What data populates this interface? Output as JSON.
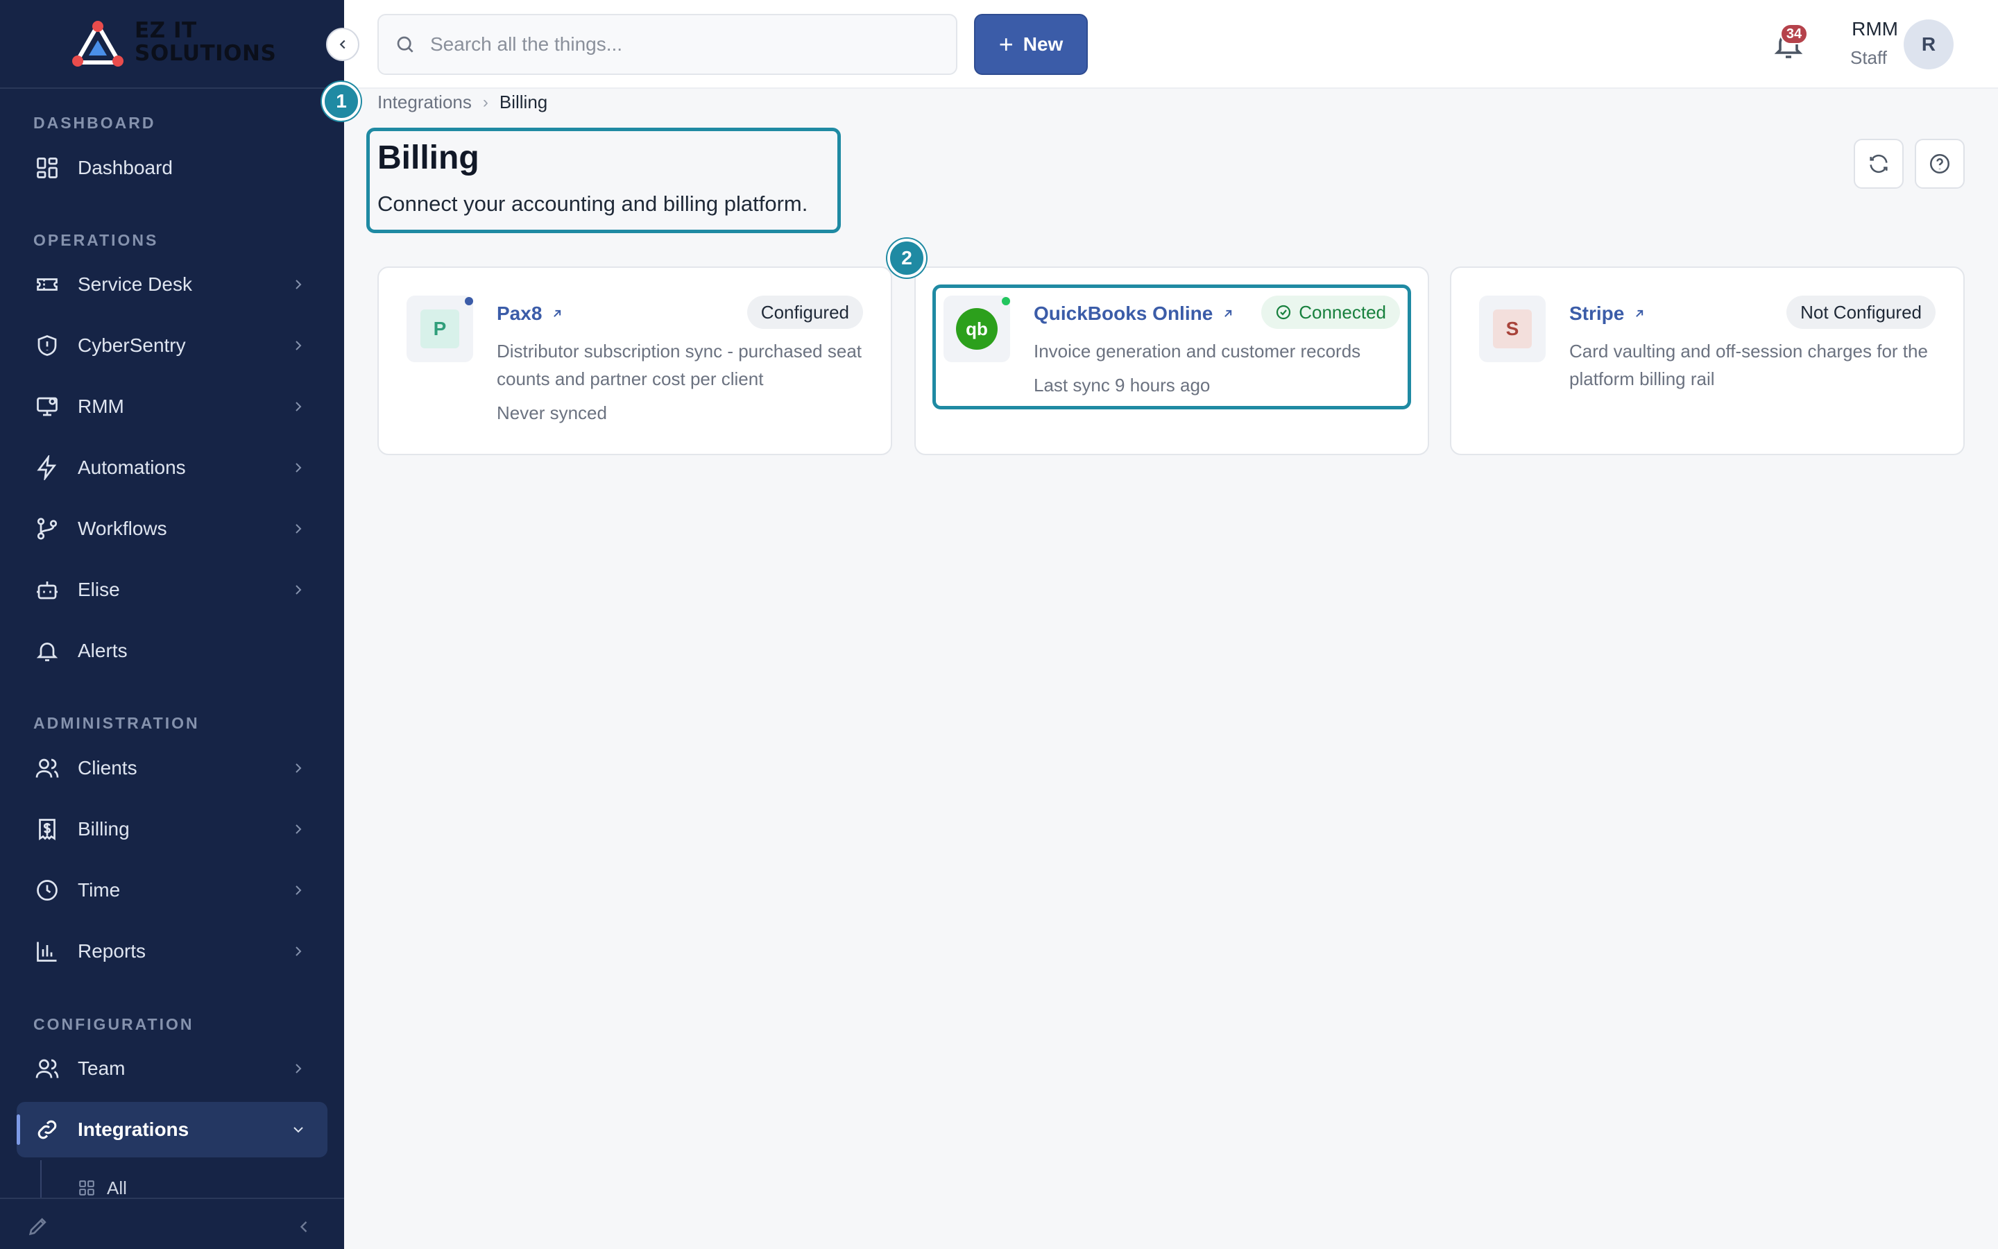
{
  "brand": {
    "line1": "EZ IT",
    "line2": "SOLUTIONS"
  },
  "sidebar": {
    "sections": [
      "DASHBOARD",
      "OPERATIONS",
      "ADMINISTRATION",
      "CONFIGURATION"
    ],
    "items": [
      {
        "label": "Dashboard",
        "icon": "grid-icon"
      },
      {
        "label": "Service Desk",
        "icon": "ticket-icon"
      },
      {
        "label": "CyberSentry",
        "icon": "shield-icon"
      },
      {
        "label": "RMM",
        "icon": "monitor-icon"
      },
      {
        "label": "Automations",
        "icon": "bolt-icon"
      },
      {
        "label": "Workflows",
        "icon": "git-branch-icon"
      },
      {
        "label": "Elise",
        "icon": "robot-icon"
      },
      {
        "label": "Alerts",
        "icon": "bell-icon"
      },
      {
        "label": "Clients",
        "icon": "users-icon"
      },
      {
        "label": "Billing",
        "icon": "receipt-icon"
      },
      {
        "label": "Time",
        "icon": "clock-icon"
      },
      {
        "label": "Reports",
        "icon": "bar-chart-icon"
      },
      {
        "label": "Team",
        "icon": "team-icon"
      },
      {
        "label": "Integrations",
        "icon": "link-icon",
        "active": true
      }
    ],
    "sub_item": "All"
  },
  "topbar": {
    "search_placeholder": "Search all the things...",
    "new_label": "New",
    "notification_count": "34",
    "user_name": "RMM",
    "user_role": "Staff",
    "avatar_initial": "R"
  },
  "breadcrumb": {
    "parent": "Integrations",
    "current": "Billing"
  },
  "page": {
    "title": "Billing",
    "subtitle": "Connect your accounting and billing platform."
  },
  "markers": [
    "1",
    "2"
  ],
  "cards": [
    {
      "logo_letter": "P",
      "name": "Pax8",
      "status": "Configured",
      "description": "Distributor subscription sync - purchased seat counts and partner cost per client",
      "sync": "Never synced",
      "dot_color": "#3b5ca8"
    },
    {
      "logo_letter": "qb",
      "name": "QuickBooks Online",
      "status": "Connected",
      "description": "Invoice generation and customer records",
      "sync": "Last sync 9 hours ago",
      "dot_color": "#22c55e"
    },
    {
      "logo_letter": "S",
      "name": "Stripe",
      "status": "Not Configured",
      "description": "Card vaulting and off-session charges for the platform billing rail"
    }
  ],
  "colors": {
    "sidebar_bg": "#162446",
    "accent": "#3b5ca8",
    "highlight": "#1f8aa3",
    "connected": "#17803d"
  }
}
